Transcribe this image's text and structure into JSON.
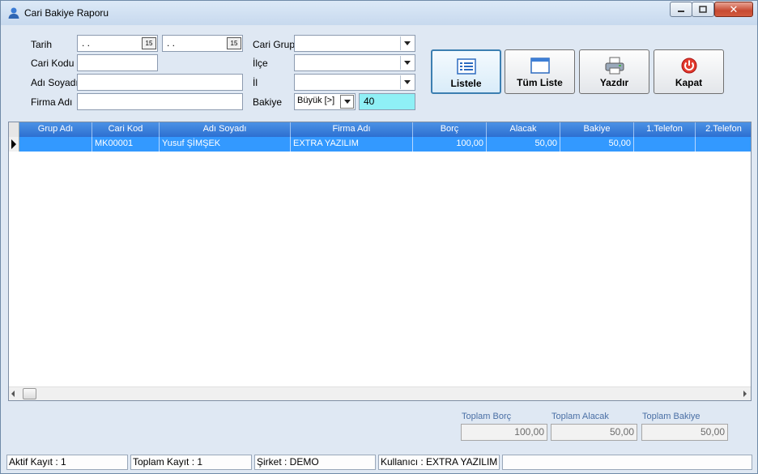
{
  "window": {
    "title": "Cari Bakiye Raporu"
  },
  "filters": {
    "tarih_label": "Tarih",
    "tarih_start": " .  .",
    "tarih_end": " .  .",
    "date_button": "15",
    "cari_kodu_label": "Cari Kodu",
    "cari_kodu_value": "",
    "adi_soyadi_label": "Adı Soyadı",
    "adi_soyadi_value": "",
    "firma_adi_label": "Firma Adı",
    "firma_adi_value": "",
    "cari_grup_label": "Cari Grup",
    "cari_grup_value": "",
    "ilce_label": "İlçe",
    "ilce_value": "",
    "il_label": "İl",
    "il_value": "",
    "bakiye_label": "Bakiye",
    "bakiye_operator": "Büyük [>]",
    "bakiye_value": "40"
  },
  "buttons": {
    "listele": "Listele",
    "tum_liste": "Tüm Liste",
    "yazdir": "Yazdır",
    "kapat": "Kapat"
  },
  "grid": {
    "columns": [
      "Grup Adı",
      "Cari Kod",
      "Adı Soyadı",
      "Firma Adı",
      "Borç",
      "Alacak",
      "Bakiye",
      "1.Telefon",
      "2.Telefon"
    ],
    "rows": [
      {
        "grup_adi": "",
        "cari_kod": "MK00001",
        "adi_soyadi": "Yusuf ŞİMŞEK",
        "firma_adi": "EXTRA YAZILIM",
        "borc": "100,00",
        "alacak": "50,00",
        "bakiye": "50,00",
        "telefon1": "",
        "telefon2": ""
      }
    ]
  },
  "totals": {
    "borc_label": "Toplam Borç",
    "borc_value": "100,00",
    "alacak_label": "Toplam Alacak",
    "alacak_value": "50,00",
    "bakiye_label": "Toplam Bakiye",
    "bakiye_value": "50,00"
  },
  "statusbar": {
    "aktif_kayit": "Aktif Kayıt : 1",
    "toplam_kayit": "Toplam Kayıt : 1",
    "sirket": "Şirket : DEMO",
    "kullanici": "Kullanıcı : EXTRA YAZILIM"
  }
}
